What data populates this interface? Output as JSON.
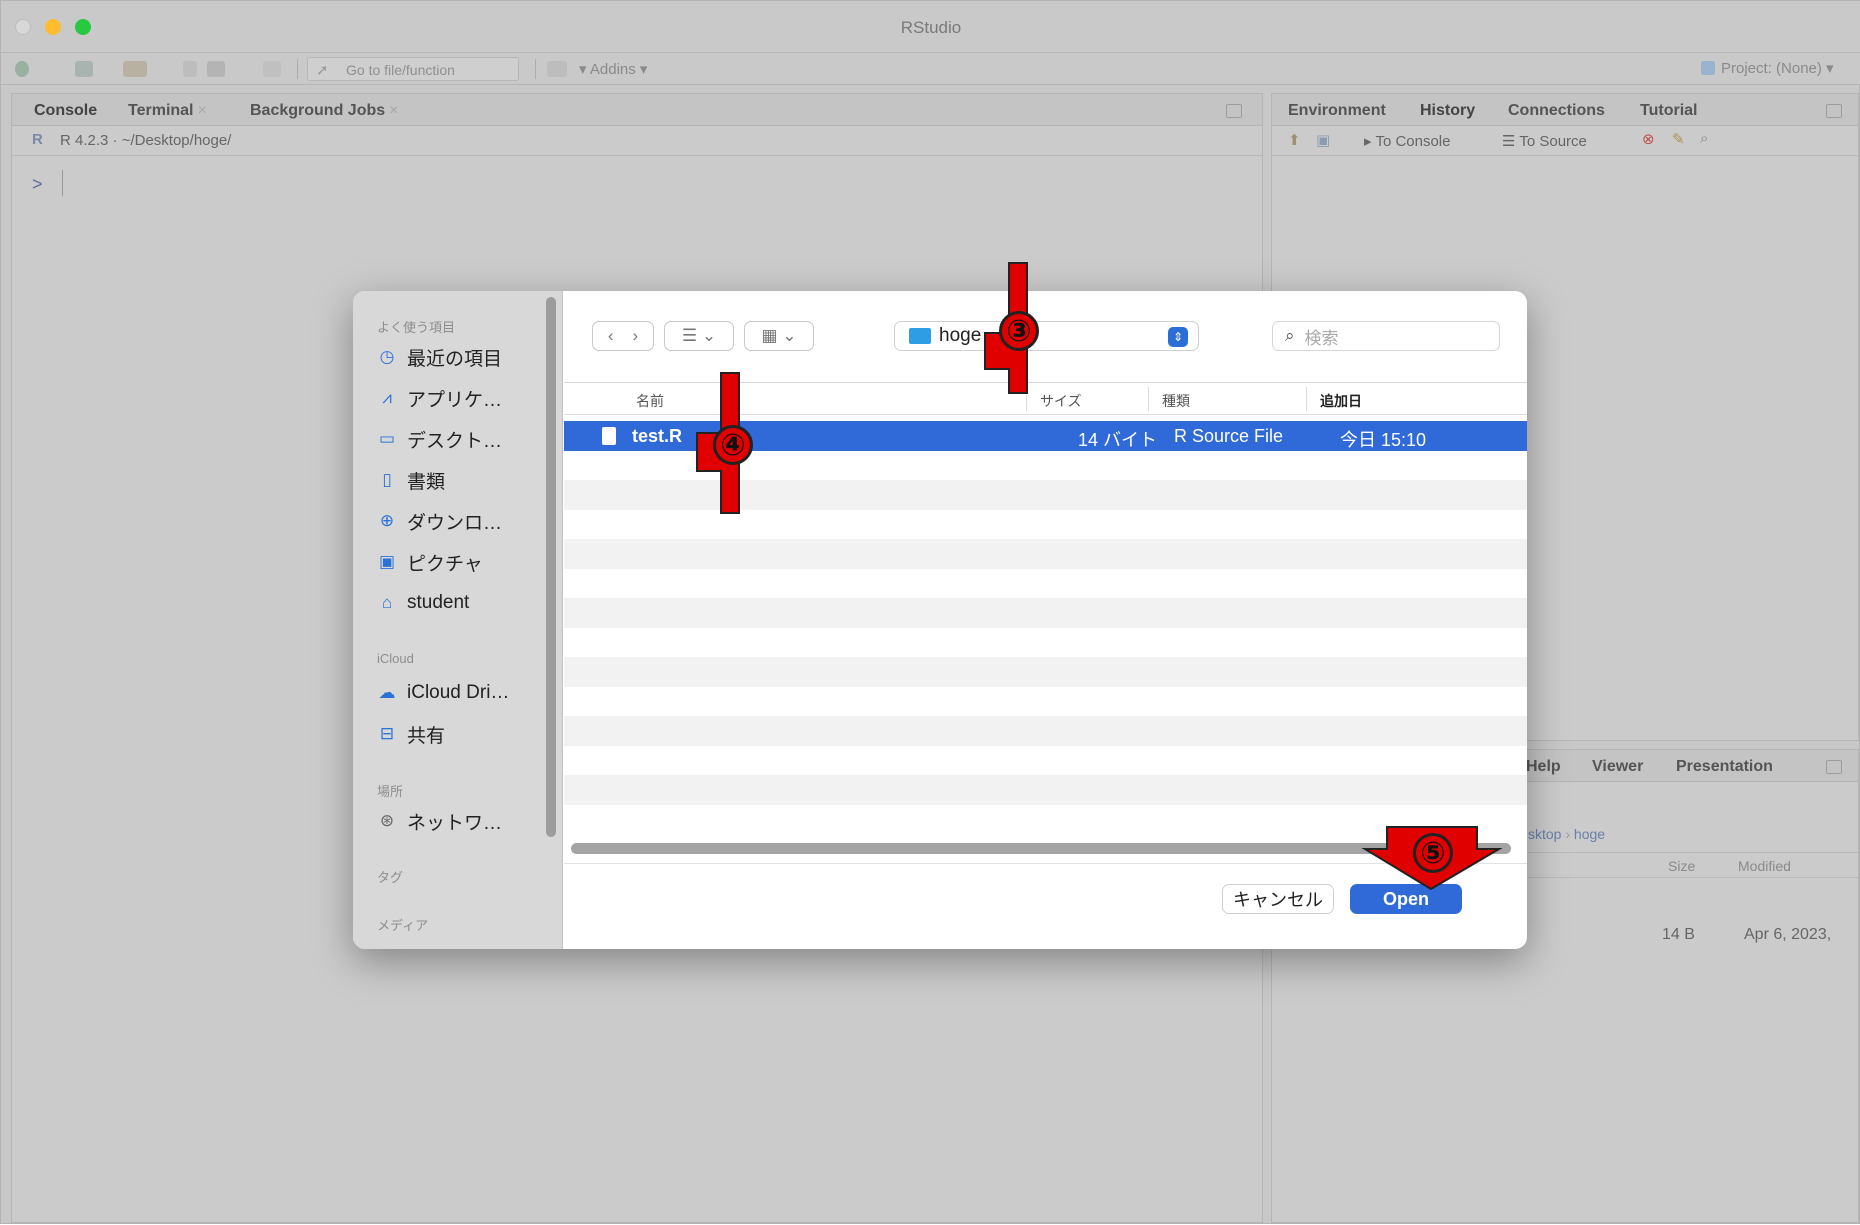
{
  "window": {
    "title": "RStudio"
  },
  "toolbar": {
    "goto_placeholder": "Go to file/function",
    "addins": "Addins",
    "project": "Project: (None)"
  },
  "console": {
    "tabs": [
      "Console",
      "Terminal",
      "Background Jobs"
    ],
    "path": "R 4.2.3 · ~/Desktop/hoge/",
    "prompt": ">"
  },
  "env_pane": {
    "tabs": [
      "Environment",
      "History",
      "Connections",
      "Tutorial"
    ],
    "to_console": "To Console",
    "to_source": "To Source"
  },
  "files_pane": {
    "tabs": [
      "Help",
      "Viewer",
      "Presentation"
    ],
    "breadcrumb": [
      "sktop",
      "hoge"
    ],
    "cols": [
      "Size",
      "Modified"
    ],
    "row": {
      "size": "14 B",
      "modified": "Apr 6, 2023,"
    }
  },
  "dialog": {
    "sidebar": {
      "favorites_header": "よく使う項目",
      "favorites": [
        {
          "icon": "clock-icon",
          "label": "最近の項目"
        },
        {
          "icon": "apps-icon",
          "label": "アプリケ…"
        },
        {
          "icon": "desktop-icon",
          "label": "デスクト…"
        },
        {
          "icon": "document-icon",
          "label": "書類"
        },
        {
          "icon": "download-icon",
          "label": "ダウンロ…"
        },
        {
          "icon": "pictures-icon",
          "label": "ピクチャ"
        },
        {
          "icon": "home-icon",
          "label": "student"
        }
      ],
      "icloud_header": "iCloud",
      "icloud": [
        {
          "icon": "cloud-icon",
          "label": "iCloud Dri…"
        },
        {
          "icon": "shared-folder-icon",
          "label": "共有"
        }
      ],
      "locations_header": "場所",
      "locations": [
        {
          "icon": "network-icon",
          "label": "ネットワ…"
        }
      ],
      "tags_header": "タグ",
      "media_header": "メディア"
    },
    "current_folder": "hoge",
    "search_placeholder": "検索",
    "columns": {
      "name": "名前",
      "size": "サイズ",
      "kind": "種類",
      "added": "追加日"
    },
    "files": [
      {
        "name": "test.R",
        "size": "14 バイト",
        "kind": "R Source File",
        "added": "今日 15:10",
        "selected": true
      }
    ],
    "cancel": "キャンセル",
    "open": "Open"
  },
  "annotations": [
    "③",
    "④",
    "⑤"
  ],
  "colors": {
    "accent": "#2f6ad8",
    "annotation_red": "#e10000",
    "traffic_red": "#ff5f57",
    "traffic_yellow": "#febc2e",
    "traffic_green": "#28c840"
  }
}
